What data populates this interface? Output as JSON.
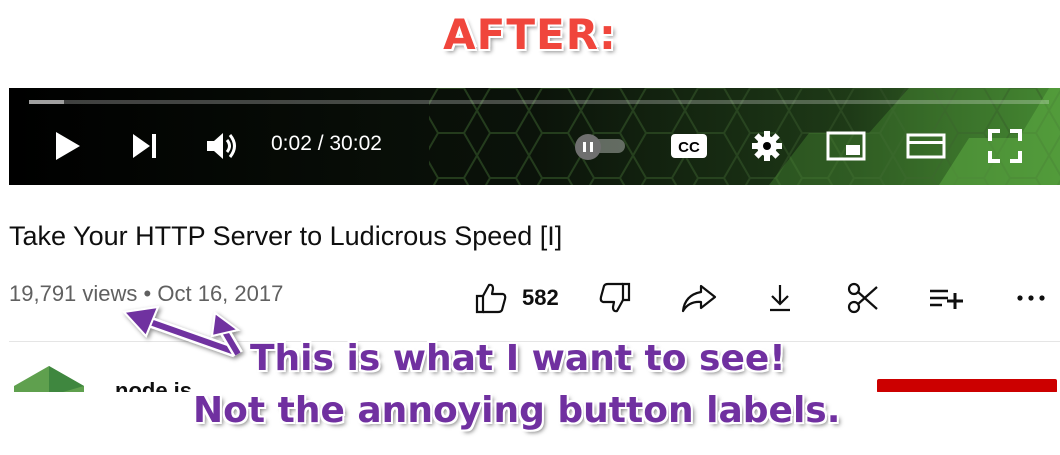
{
  "header": {
    "title": "AFTER:"
  },
  "player": {
    "time": "0:02 / 30:02",
    "progress_fraction": 0.034,
    "icons": [
      "play-icon",
      "next-icon",
      "volume-icon",
      "autoplay-pause-icon",
      "cc-icon",
      "settings-icon",
      "miniplayer-icon",
      "theater-icon",
      "fullscreen-icon"
    ],
    "cc_label": "CC"
  },
  "video": {
    "title": "Take Your HTTP Server to Ludicrous Speed [I]",
    "views": "19,791 views",
    "separator": "•",
    "date": "Oct 16, 2017",
    "like_count": "582"
  },
  "channel": {
    "name": "node.js"
  },
  "annotation": {
    "line1": "This is what I want to see!",
    "line2": "Not the annoying button labels."
  },
  "colors": {
    "title_red": "#f0463c",
    "annotation_purple": "#7030a0",
    "subscribe_red": "#cc0000",
    "hex_green": "#4f9a3a"
  }
}
